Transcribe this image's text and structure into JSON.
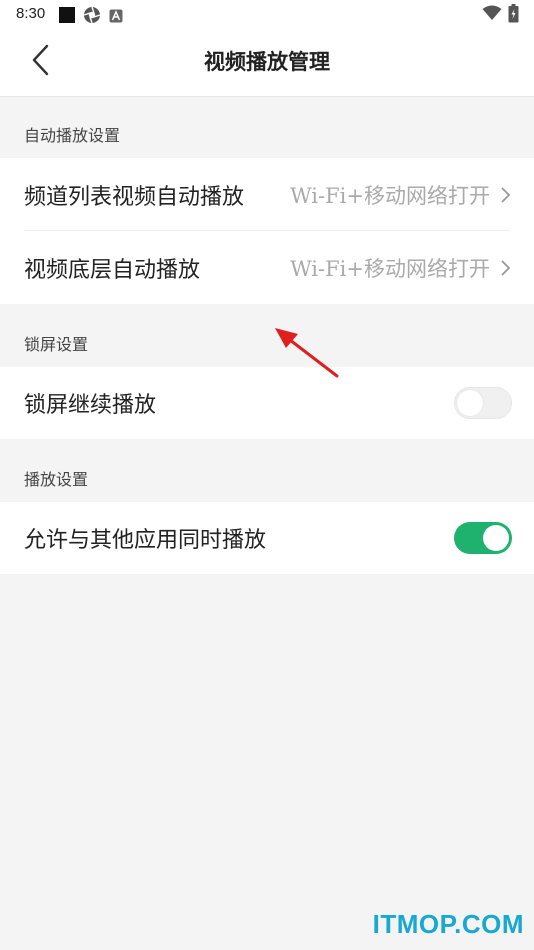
{
  "status_bar": {
    "time": "8:30",
    "icons": [
      "square-notification-icon",
      "aperture-icon",
      "a-box-icon",
      "wifi-icon",
      "battery-charging-icon"
    ]
  },
  "header": {
    "title": "视频播放管理",
    "back_icon": "chevron-left-icon"
  },
  "sections": {
    "autoplay": {
      "header": "自动播放设置",
      "items": [
        {
          "label": "频道列表视频自动播放",
          "value": "Wi-Fi+移动网络打开"
        },
        {
          "label": "视频底层自动播放",
          "value": "Wi-Fi+移动网络打开"
        }
      ]
    },
    "lockscreen": {
      "header": "锁屏设置",
      "item": {
        "label": "锁屏继续播放",
        "toggle": false
      }
    },
    "playback": {
      "header": "播放设置",
      "item": {
        "label": "允许与其他应用同时播放",
        "toggle": true
      }
    }
  },
  "annotation": {
    "icon": "red-arrow-icon",
    "color": "#e02020"
  },
  "watermark": {
    "text": "ITMOP.COM",
    "color": "#18a8d0"
  },
  "colors": {
    "toggle_on": "#1fb26e",
    "background": "#f4f4f4"
  }
}
